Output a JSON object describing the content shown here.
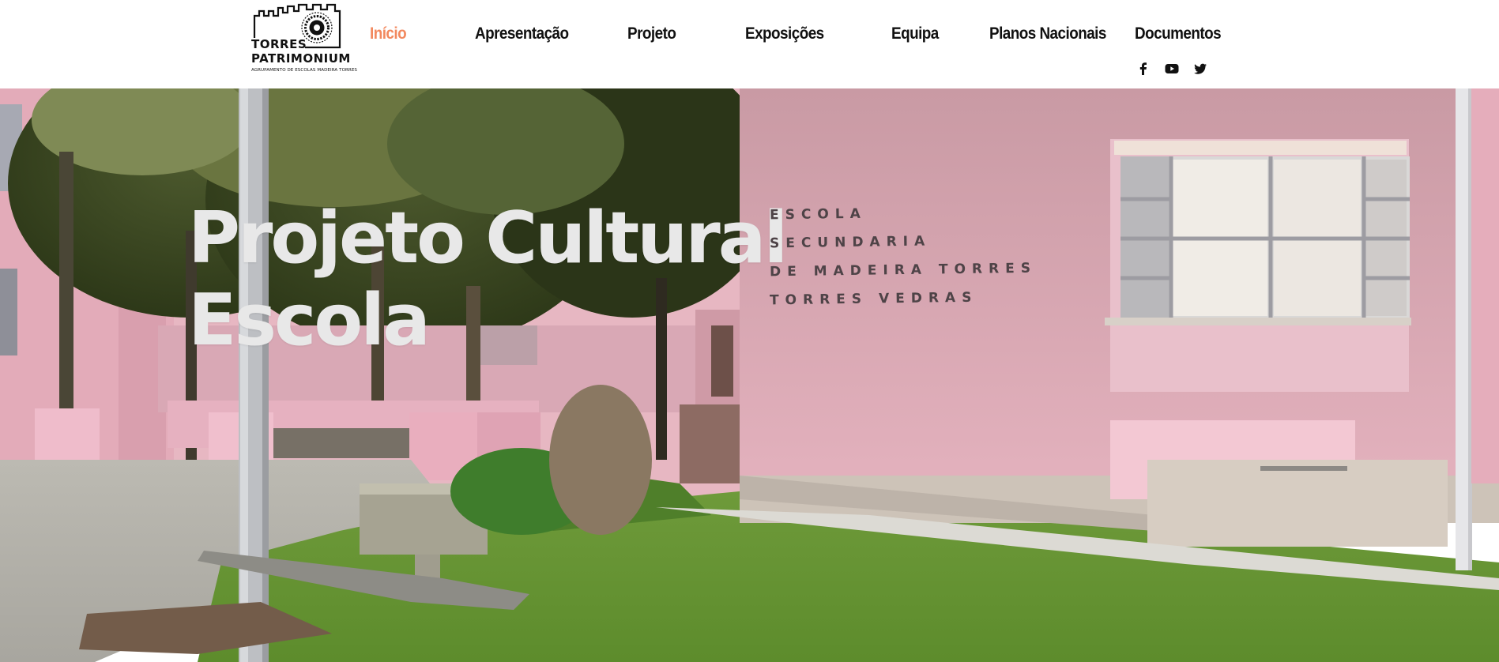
{
  "logo": {
    "line1": "TORRES",
    "line2": "PATRIMONIUM",
    "line3": "AGRUPAMENTO DE ESCOLAS MADEIRA TORRES"
  },
  "nav": {
    "items": [
      {
        "label": "Início",
        "active": true
      },
      {
        "label": "Apresentação",
        "active": false
      },
      {
        "label": "Projeto",
        "active": false
      },
      {
        "label": "Exposições",
        "active": false
      },
      {
        "label": "Equipa",
        "active": false
      },
      {
        "label": "Planos Nacionais",
        "active": false
      },
      {
        "label": "Documentos",
        "active": false
      }
    ],
    "active_color": "#f2895f"
  },
  "social": [
    "facebook-icon",
    "youtube-icon",
    "twitter-icon"
  ],
  "hero": {
    "title_line1": "Projeto Cultural",
    "title_line2": "Escola",
    "sign": [
      "ESCOLA",
      "SECUNDARIA",
      "DE MADEIRA TORRES",
      "TORRES VEDRAS"
    ]
  }
}
